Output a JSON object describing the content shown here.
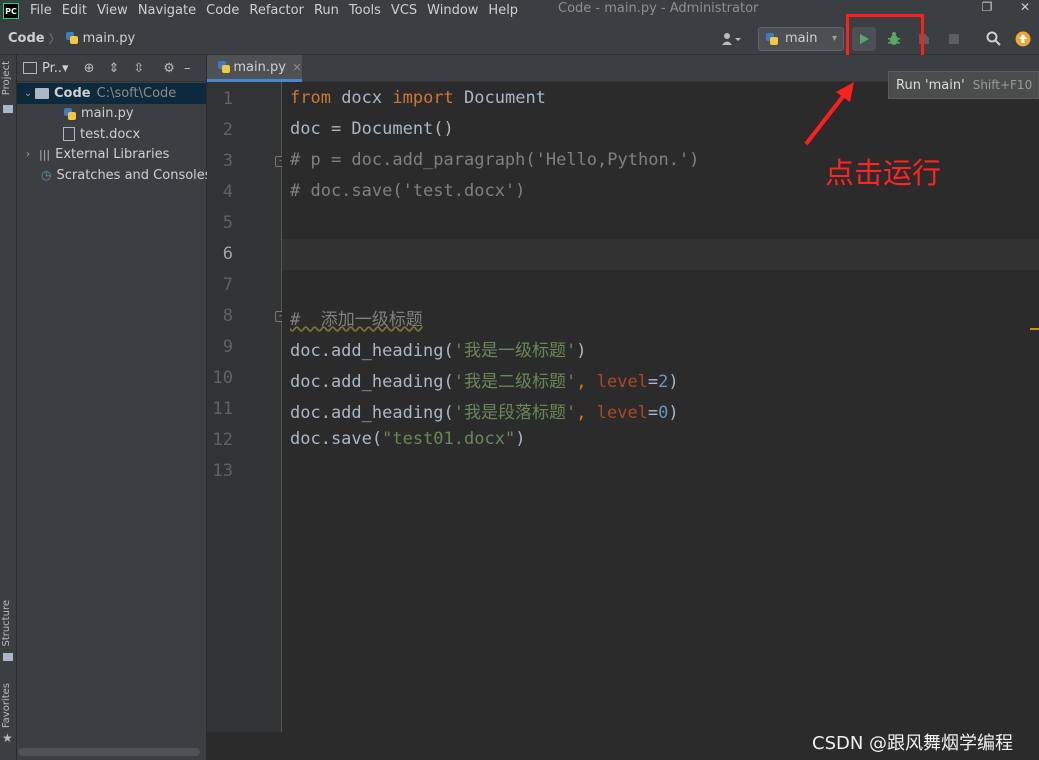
{
  "menubar": {
    "logo": "PC",
    "items": [
      "File",
      "Edit",
      "View",
      "Navigate",
      "Code",
      "Refactor",
      "Run",
      "Tools",
      "VCS",
      "Window",
      "Help"
    ],
    "window_title": "Code - main.py - Administrator",
    "restore_glyph": "❐",
    "close_glyph": "✕"
  },
  "navbar": {
    "project": "Code",
    "file": "main.py",
    "run_config": "main",
    "icons": [
      "user-icon",
      "python-icon",
      "run-icon",
      "debug-icon",
      "coverage-icon",
      "stop-icon",
      "search-icon",
      "update-icon"
    ]
  },
  "tooltip": {
    "label": "Run 'main'",
    "shortcut": "Shift+F10"
  },
  "left_strip": {
    "project": "Project",
    "structure": "Structure",
    "favorites": "Favorites"
  },
  "project_panel": {
    "title": "Pr..▾",
    "root": {
      "name": "Code",
      "path": "C:\\soft\\Code"
    },
    "files": [
      "main.py",
      "test.docx"
    ],
    "external_libraries": "External Libraries",
    "scratches": "Scratches and Consoles"
  },
  "editor": {
    "tab": "main.py",
    "line_numbers": [
      "1",
      "2",
      "3",
      "4",
      "5",
      "6",
      "7",
      "8",
      "9",
      "10",
      "11",
      "12",
      "13"
    ],
    "current_line": 6,
    "lines": {
      "l1": {
        "k1": "from",
        "t1": " docx ",
        "k2": "import",
        "t2": " Document"
      },
      "l2": "doc = Document()",
      "l3": "# p = doc.add_paragraph('Hello,Python.')",
      "l4": "# doc.save('test.docx')",
      "l8": "#  添加一级标题",
      "l9": {
        "pre": "doc.add_heading(",
        "str": "'我是一级标题'",
        "post": ")"
      },
      "l10": {
        "pre": "doc.add_heading(",
        "str": "'我是二级标题'",
        "comma": ", ",
        "param": "level",
        "eq": "=",
        "num": "2",
        "post": ")"
      },
      "l11": {
        "pre": "doc.add_heading(",
        "str": "'我是段落标题'",
        "comma": ", ",
        "param": "level",
        "eq": "=",
        "num": "0",
        "post": ")"
      },
      "l12": {
        "pre": "doc.save(",
        "str": "\"test01.docx\"",
        "post": ")"
      }
    }
  },
  "annotation": "点击运行",
  "watermark": "CSDN @跟风舞烟学编程",
  "colors": {
    "highlight": "#ff1f1f",
    "annotation": "#ff2323",
    "keyword": "#cc7832",
    "string": "#6a8759",
    "number": "#6897bb"
  }
}
